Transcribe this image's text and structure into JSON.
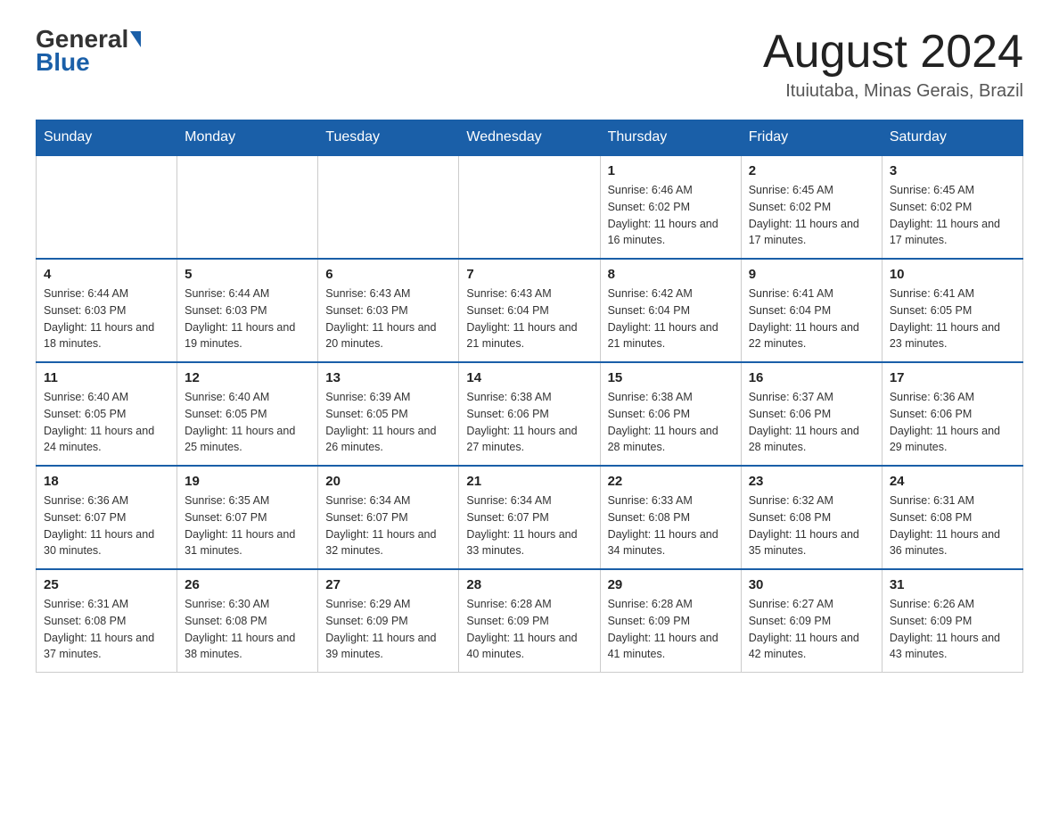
{
  "header": {
    "logo_general": "General",
    "logo_blue": "Blue",
    "month_title": "August 2024",
    "location": "Ituiutaba, Minas Gerais, Brazil"
  },
  "days_of_week": [
    "Sunday",
    "Monday",
    "Tuesday",
    "Wednesday",
    "Thursday",
    "Friday",
    "Saturday"
  ],
  "weeks": [
    [
      {
        "day": "",
        "info": ""
      },
      {
        "day": "",
        "info": ""
      },
      {
        "day": "",
        "info": ""
      },
      {
        "day": "",
        "info": ""
      },
      {
        "day": "1",
        "info": "Sunrise: 6:46 AM\nSunset: 6:02 PM\nDaylight: 11 hours and 16 minutes."
      },
      {
        "day": "2",
        "info": "Sunrise: 6:45 AM\nSunset: 6:02 PM\nDaylight: 11 hours and 17 minutes."
      },
      {
        "day": "3",
        "info": "Sunrise: 6:45 AM\nSunset: 6:02 PM\nDaylight: 11 hours and 17 minutes."
      }
    ],
    [
      {
        "day": "4",
        "info": "Sunrise: 6:44 AM\nSunset: 6:03 PM\nDaylight: 11 hours and 18 minutes."
      },
      {
        "day": "5",
        "info": "Sunrise: 6:44 AM\nSunset: 6:03 PM\nDaylight: 11 hours and 19 minutes."
      },
      {
        "day": "6",
        "info": "Sunrise: 6:43 AM\nSunset: 6:03 PM\nDaylight: 11 hours and 20 minutes."
      },
      {
        "day": "7",
        "info": "Sunrise: 6:43 AM\nSunset: 6:04 PM\nDaylight: 11 hours and 21 minutes."
      },
      {
        "day": "8",
        "info": "Sunrise: 6:42 AM\nSunset: 6:04 PM\nDaylight: 11 hours and 21 minutes."
      },
      {
        "day": "9",
        "info": "Sunrise: 6:41 AM\nSunset: 6:04 PM\nDaylight: 11 hours and 22 minutes."
      },
      {
        "day": "10",
        "info": "Sunrise: 6:41 AM\nSunset: 6:05 PM\nDaylight: 11 hours and 23 minutes."
      }
    ],
    [
      {
        "day": "11",
        "info": "Sunrise: 6:40 AM\nSunset: 6:05 PM\nDaylight: 11 hours and 24 minutes."
      },
      {
        "day": "12",
        "info": "Sunrise: 6:40 AM\nSunset: 6:05 PM\nDaylight: 11 hours and 25 minutes."
      },
      {
        "day": "13",
        "info": "Sunrise: 6:39 AM\nSunset: 6:05 PM\nDaylight: 11 hours and 26 minutes."
      },
      {
        "day": "14",
        "info": "Sunrise: 6:38 AM\nSunset: 6:06 PM\nDaylight: 11 hours and 27 minutes."
      },
      {
        "day": "15",
        "info": "Sunrise: 6:38 AM\nSunset: 6:06 PM\nDaylight: 11 hours and 28 minutes."
      },
      {
        "day": "16",
        "info": "Sunrise: 6:37 AM\nSunset: 6:06 PM\nDaylight: 11 hours and 28 minutes."
      },
      {
        "day": "17",
        "info": "Sunrise: 6:36 AM\nSunset: 6:06 PM\nDaylight: 11 hours and 29 minutes."
      }
    ],
    [
      {
        "day": "18",
        "info": "Sunrise: 6:36 AM\nSunset: 6:07 PM\nDaylight: 11 hours and 30 minutes."
      },
      {
        "day": "19",
        "info": "Sunrise: 6:35 AM\nSunset: 6:07 PM\nDaylight: 11 hours and 31 minutes."
      },
      {
        "day": "20",
        "info": "Sunrise: 6:34 AM\nSunset: 6:07 PM\nDaylight: 11 hours and 32 minutes."
      },
      {
        "day": "21",
        "info": "Sunrise: 6:34 AM\nSunset: 6:07 PM\nDaylight: 11 hours and 33 minutes."
      },
      {
        "day": "22",
        "info": "Sunrise: 6:33 AM\nSunset: 6:08 PM\nDaylight: 11 hours and 34 minutes."
      },
      {
        "day": "23",
        "info": "Sunrise: 6:32 AM\nSunset: 6:08 PM\nDaylight: 11 hours and 35 minutes."
      },
      {
        "day": "24",
        "info": "Sunrise: 6:31 AM\nSunset: 6:08 PM\nDaylight: 11 hours and 36 minutes."
      }
    ],
    [
      {
        "day": "25",
        "info": "Sunrise: 6:31 AM\nSunset: 6:08 PM\nDaylight: 11 hours and 37 minutes."
      },
      {
        "day": "26",
        "info": "Sunrise: 6:30 AM\nSunset: 6:08 PM\nDaylight: 11 hours and 38 minutes."
      },
      {
        "day": "27",
        "info": "Sunrise: 6:29 AM\nSunset: 6:09 PM\nDaylight: 11 hours and 39 minutes."
      },
      {
        "day": "28",
        "info": "Sunrise: 6:28 AM\nSunset: 6:09 PM\nDaylight: 11 hours and 40 minutes."
      },
      {
        "day": "29",
        "info": "Sunrise: 6:28 AM\nSunset: 6:09 PM\nDaylight: 11 hours and 41 minutes."
      },
      {
        "day": "30",
        "info": "Sunrise: 6:27 AM\nSunset: 6:09 PM\nDaylight: 11 hours and 42 minutes."
      },
      {
        "day": "31",
        "info": "Sunrise: 6:26 AM\nSunset: 6:09 PM\nDaylight: 11 hours and 43 minutes."
      }
    ]
  ]
}
